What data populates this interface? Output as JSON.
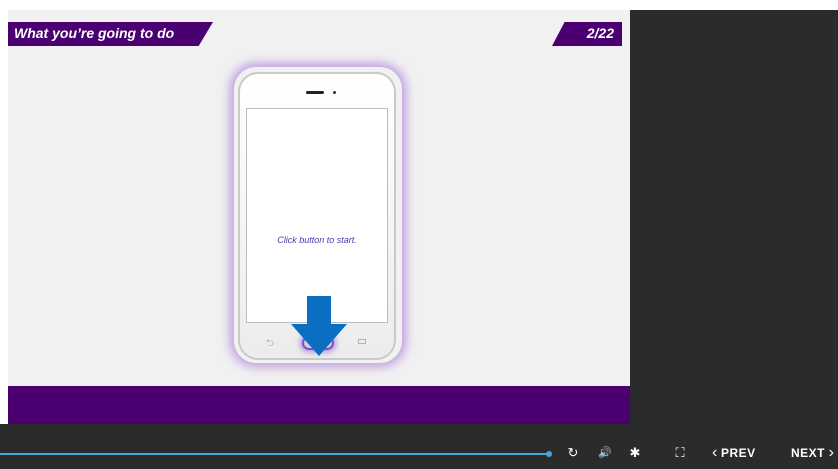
{
  "slide": {
    "title": "What you’re going to do",
    "counter": "2/22",
    "instruction": "Click button to start."
  },
  "colors": {
    "brand_purple": "#4a0070",
    "arrow_blue": "#0a6fc2",
    "progress_blue": "#4aa6d8"
  },
  "icons": [
    "replay-icon",
    "volume-icon",
    "settings-icon",
    "fullscreen-icon",
    "back-key-icon",
    "menu-key-icon",
    "home-button-icon",
    "down-arrow-icon"
  ],
  "player": {
    "progress": 0.656,
    "prev_label": "PREV",
    "next_label": "NEXT",
    "prev_glyph": "‹",
    "next_glyph": "›",
    "replay_glyph": "↻",
    "volume_glyph": "🔊",
    "settings_glyph": "✱",
    "fullscreen_glyph": "⛶"
  }
}
